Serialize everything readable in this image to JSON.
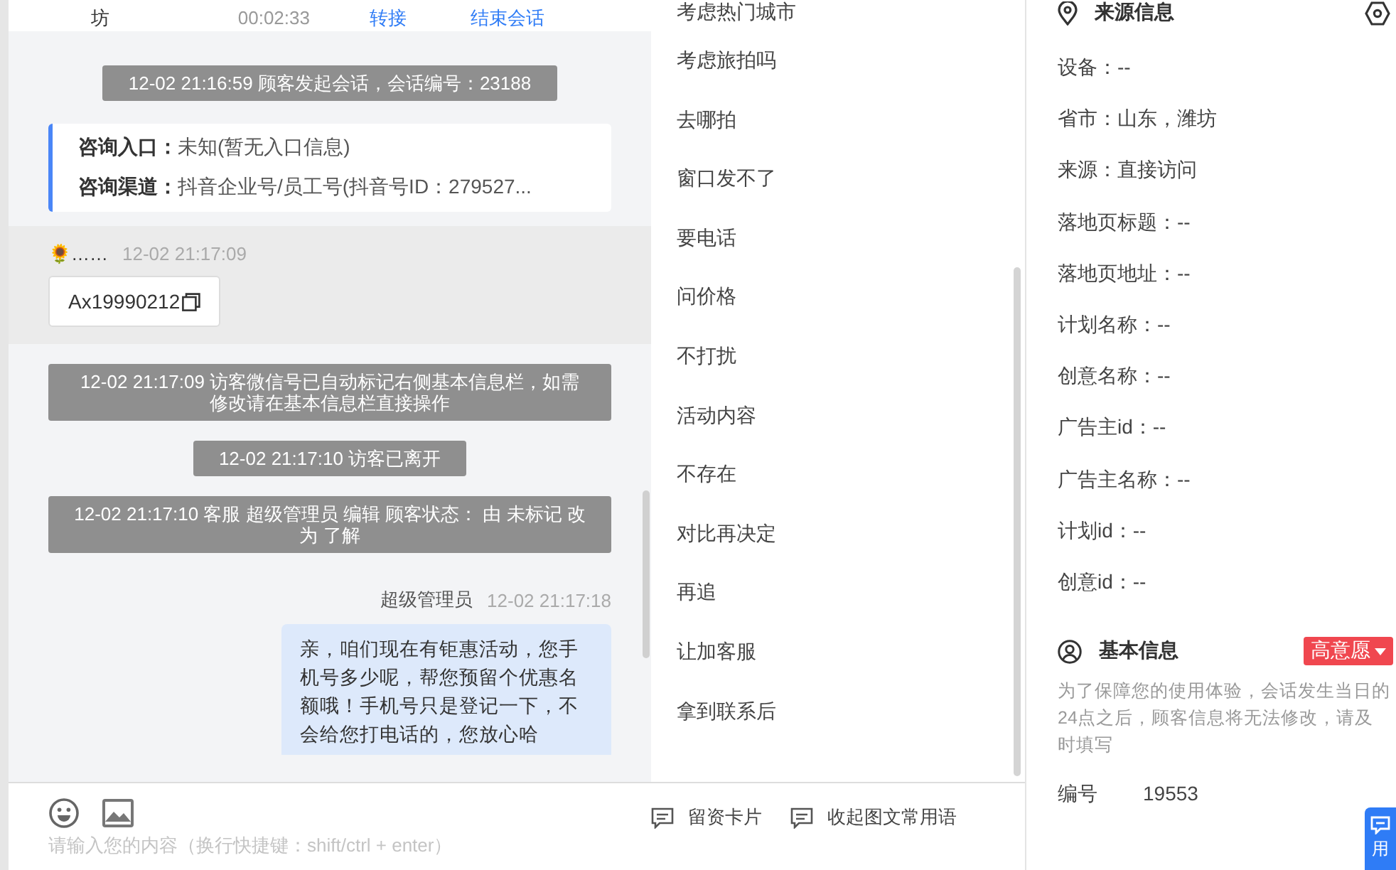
{
  "session_bar": {
    "visitor": "坊",
    "duration": "00:02:33",
    "actions": [
      {
        "label": "转接"
      },
      {
        "label": "结束会话"
      }
    ]
  },
  "chat": {
    "messages": [
      {
        "kind": "system",
        "text": "12-02 21:16:59 顾客发起会话，会话编号：23188"
      },
      {
        "kind": "entry_card",
        "rows": [
          {
            "label": "咨询入口：",
            "value": "未知(暂无入口信息)"
          },
          {
            "label": "咨询渠道：",
            "value": "抖音企业号/员工号(抖音号ID：279527..."
          }
        ]
      },
      {
        "kind": "visitor",
        "name": "🌻……",
        "time": "12-02 21:17:09",
        "text": "Ax19990212"
      },
      {
        "kind": "system",
        "text": "12-02 21:17:09 访客微信号已自动标记右侧基本信息栏，如需修改请在基本信息栏直接操作"
      },
      {
        "kind": "system",
        "text": "12-02 21:17:10 访客已离开"
      },
      {
        "kind": "system",
        "text": "12-02 21:17:10 客服 超级管理员 编辑 顾客状态： 由 未标记 改为 了解"
      },
      {
        "kind": "agent",
        "name": "超级管理员",
        "time": "12-02 21:17:18",
        "text": "亲，咱们现在有钜惠活动，您手机号多少呢，帮您预留个优惠名额哦！手机号只是登记一下，不会给您打电话的，您放心哈"
      }
    ]
  },
  "composer": {
    "placeholder": "请输入您的内容（换行快捷键：shift/ctrl + enter）"
  },
  "quick_phrases": [
    "考虑热门城市",
    "考虑旅拍吗",
    "去哪拍",
    "窗口发不了",
    "要电话",
    "问价格",
    "不打扰",
    "活动内容",
    "不存在",
    "对比再决定",
    "再追",
    "让加客服",
    "拿到联系后"
  ],
  "phrase_toolbar": [
    {
      "label": "留资卡片"
    },
    {
      "label": "收起图文常用语"
    }
  ],
  "source_info": {
    "title": "来源信息",
    "fields": [
      "设备：--",
      "省市：山东，潍坊",
      "来源：直接访问",
      "落地页标题：--",
      "落地页地址：--",
      "计划名称：--",
      "创意名称：--",
      "广告主id：--",
      "广告主名称：--",
      "计划id：--",
      "创意id：--"
    ]
  },
  "basic_info": {
    "title": "基本信息",
    "intent_tag": "高意愿",
    "note": "为了保障您的使用体验，会话发生当日的24点之后，顾客信息将无法修改，请及时填写",
    "fields": [
      {
        "label": "编号",
        "value": "19553"
      }
    ]
  },
  "floating_tab": {
    "label": "用"
  }
}
